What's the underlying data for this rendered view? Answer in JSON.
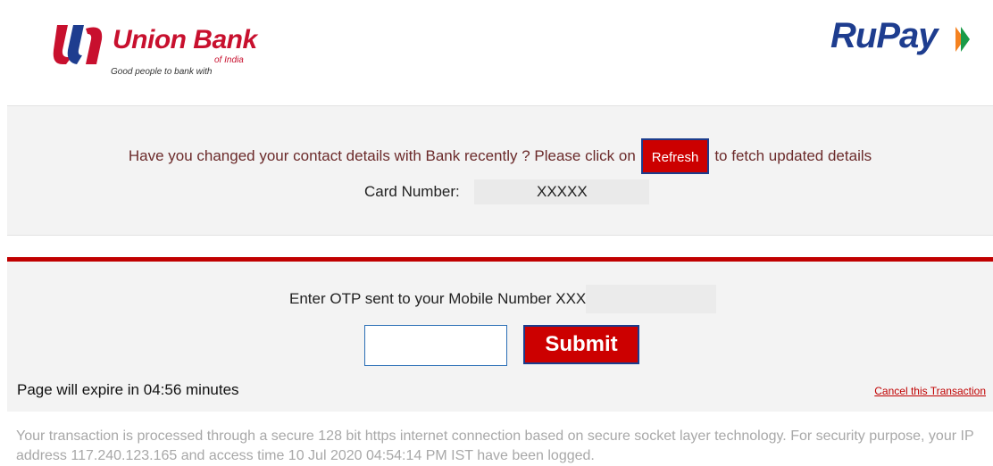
{
  "header": {
    "bank_name": "Union Bank",
    "bank_subname": "of India",
    "bank_tagline": "Good people to bank with",
    "network_name": "RuPay",
    "brand_red": "#c8102e",
    "brand_blue": "#1e3d8f"
  },
  "contact_notice": {
    "text_before": "Have you changed your contact details with Bank recently ? Please click on",
    "refresh_label": "Refresh",
    "text_after": "to fetch updated details"
  },
  "card": {
    "label": "Card Number:",
    "value": "XXXXX"
  },
  "otp": {
    "prompt": "Enter OTP sent to your Mobile Number XXXXXX",
    "input_value": "",
    "submit_label": "Submit"
  },
  "status": {
    "expire_text": "Page will expire in 04:56 minutes",
    "cancel_label": "Cancel this Transaction"
  },
  "footer": {
    "security_note": "Your transaction is processed through a secure 128 bit https internet connection based on secure socket layer technology. For security purpose, your IP address 117.240.123.165 and access time 10 Jul 2020 04:54:14 PM IST have been logged."
  }
}
